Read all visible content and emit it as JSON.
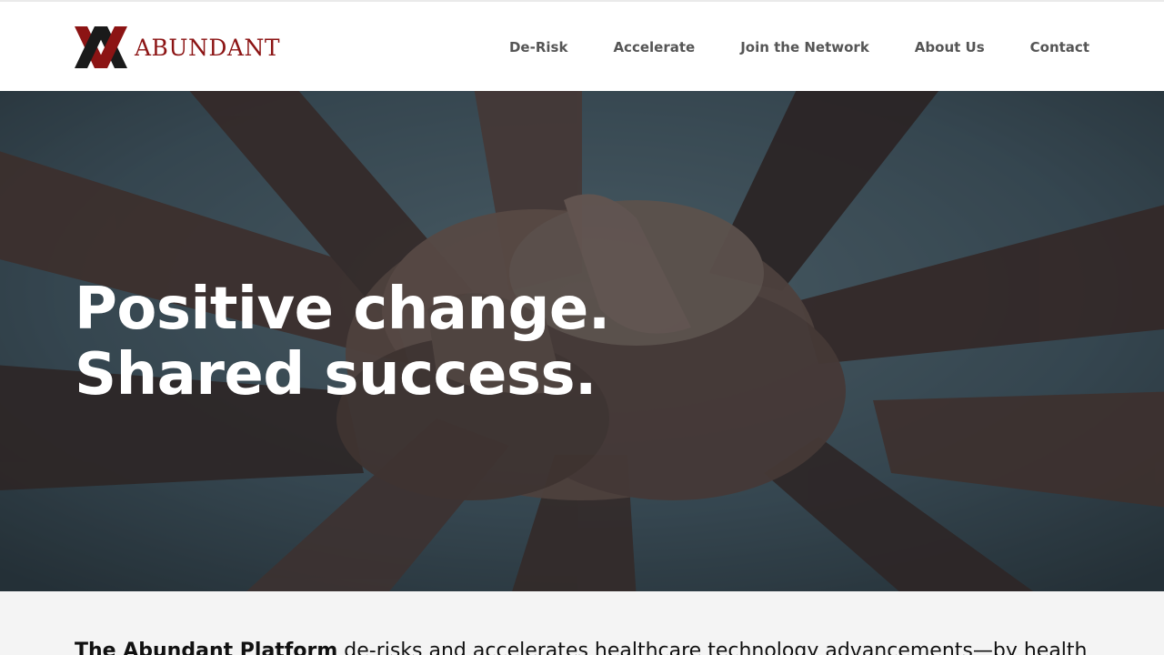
{
  "brand": {
    "name": "ABUNDANT",
    "colors": {
      "primary": "#8c1414",
      "dark": "#1a1a1a"
    }
  },
  "nav": {
    "items": [
      {
        "label": "De-Risk"
      },
      {
        "label": "Accelerate"
      },
      {
        "label": "Join the Network"
      },
      {
        "label": "About Us"
      },
      {
        "label": "Contact"
      }
    ]
  },
  "hero": {
    "line1": "Positive change.",
    "line2": "Shared success.",
    "image_subject": "stacked hands team photo"
  },
  "intro": {
    "lead": "The Abundant Platform",
    "rest": " de-risks and accelerates healthcare technology advancements—by health"
  }
}
